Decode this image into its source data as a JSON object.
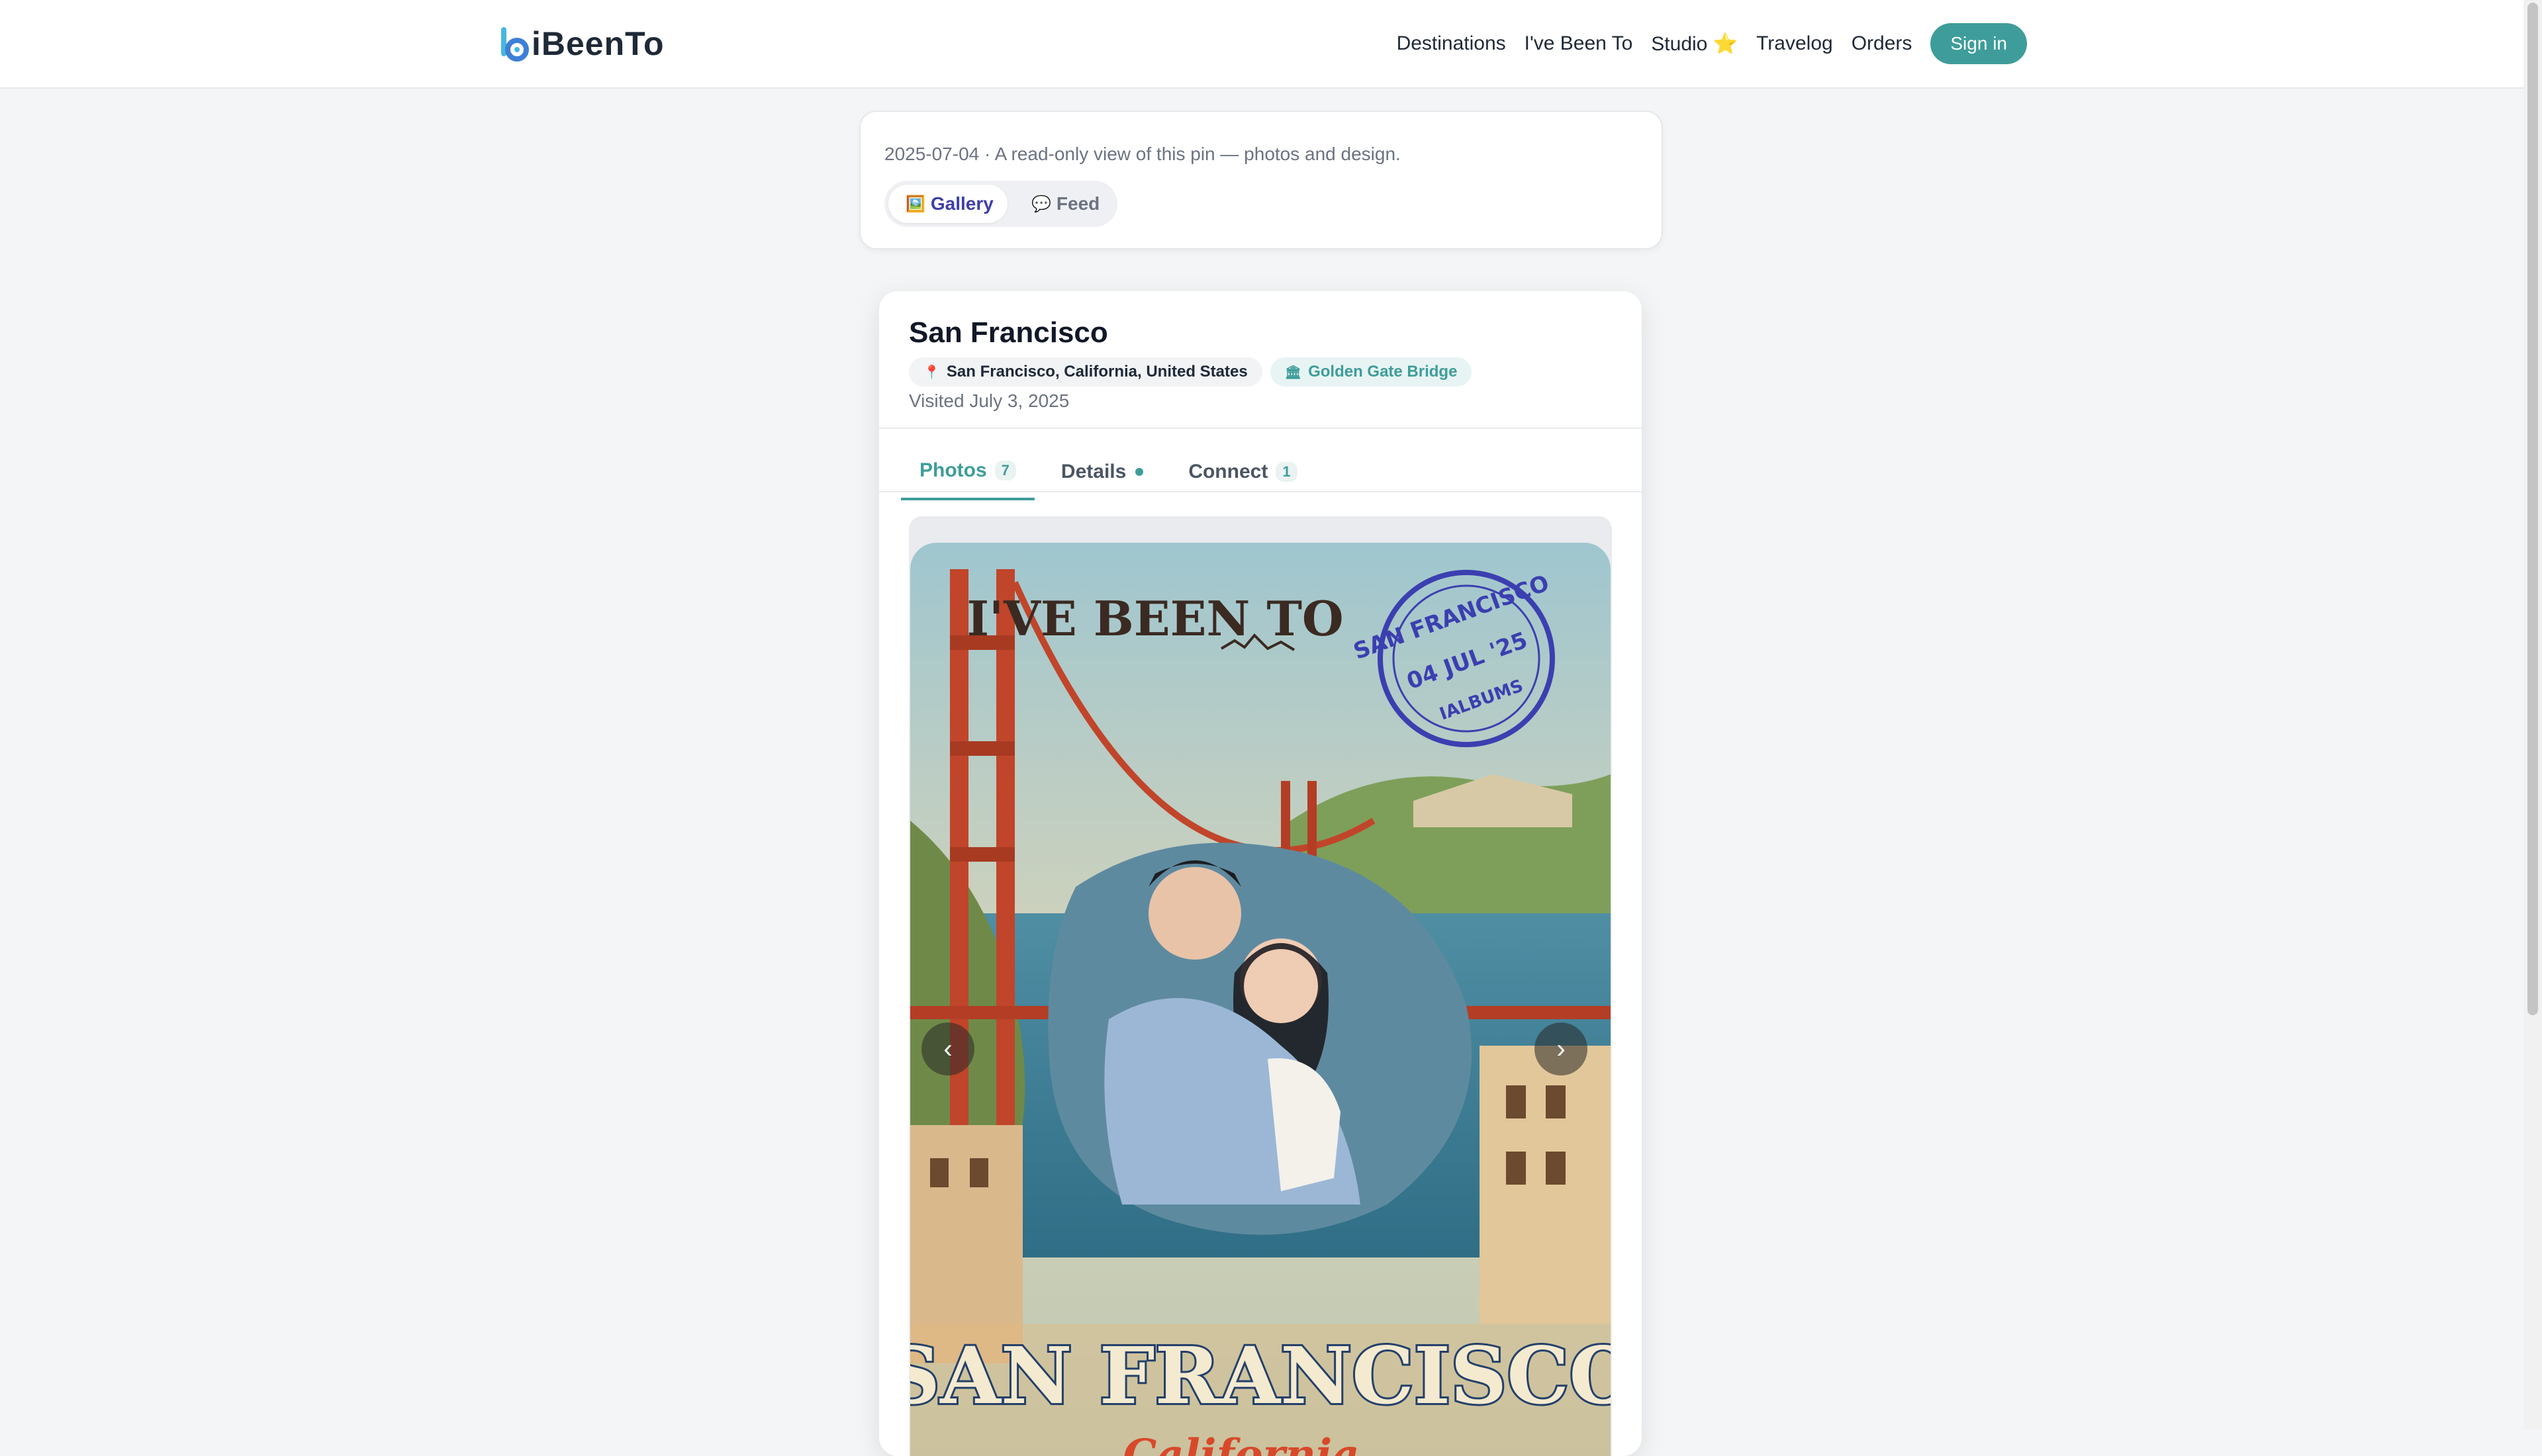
{
  "header": {
    "logo_text": "iBeenTo",
    "nav": [
      "Destinations",
      "I've Been To",
      "Studio",
      "Travelog",
      "Orders"
    ],
    "studio_star": "⭐",
    "signin_label": "Sign in"
  },
  "info": {
    "line": "2025-07-04 · A read-only view of this pin — photos and design.",
    "view_toggle": {
      "gallery_icon": "🖼️",
      "gallery_label": "Gallery",
      "feed_icon": "💬",
      "feed_label": "Feed",
      "selected": "Gallery"
    }
  },
  "pin": {
    "title": "San Francisco",
    "location_icon": "📍",
    "location": "San Francisco, California, United States",
    "landmark_icon": "🏛",
    "landmark": "Golden Gate Bridge",
    "visited": "Visited July 3, 2025",
    "tabs": [
      {
        "label": "Photos",
        "badge": "7"
      },
      {
        "label": "Details"
      },
      {
        "label": "Connect",
        "badge": "1"
      }
    ],
    "active_tab": "Photos"
  },
  "photo": {
    "headline": "I'VE BEEN TO",
    "stamp_city": "SAN FRANCISCO",
    "stamp_date": "04 JUL '25",
    "stamp_brand": "IALBUMS",
    "banner": "SAN FRANCISCO",
    "script": "California",
    "prev_label": "‹",
    "next_label": "›"
  },
  "colors": {
    "accent": "#3e9d9a",
    "gallery_active": "#3f3fa6",
    "stamp": "#3b3fb0"
  }
}
